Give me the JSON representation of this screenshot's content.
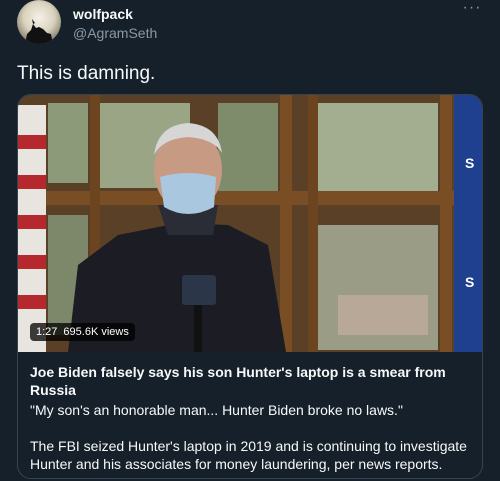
{
  "author": {
    "name": "wolfpack",
    "handle": "@AgramSeth"
  },
  "menu": {
    "more_label": "···"
  },
  "tweet": {
    "text": "This is damning."
  },
  "video": {
    "duration": "1:27",
    "views": "695.6K views",
    "side_letters": [
      "S",
      "S"
    ]
  },
  "card": {
    "title": "Joe Biden falsely says his son Hunter's laptop is a smear from Russia",
    "quote": "\"My son's an honorable man... Hunter Biden broke no laws.\"",
    "body": "The FBI seized Hunter's laptop in 2019 and is continuing to investigate Hunter and his associates for money laundering, per news reports."
  },
  "colors": {
    "background": "#15202b",
    "text": "#f7f9f9",
    "secondary_text": "#8b98a5",
    "border": "#38444d"
  }
}
